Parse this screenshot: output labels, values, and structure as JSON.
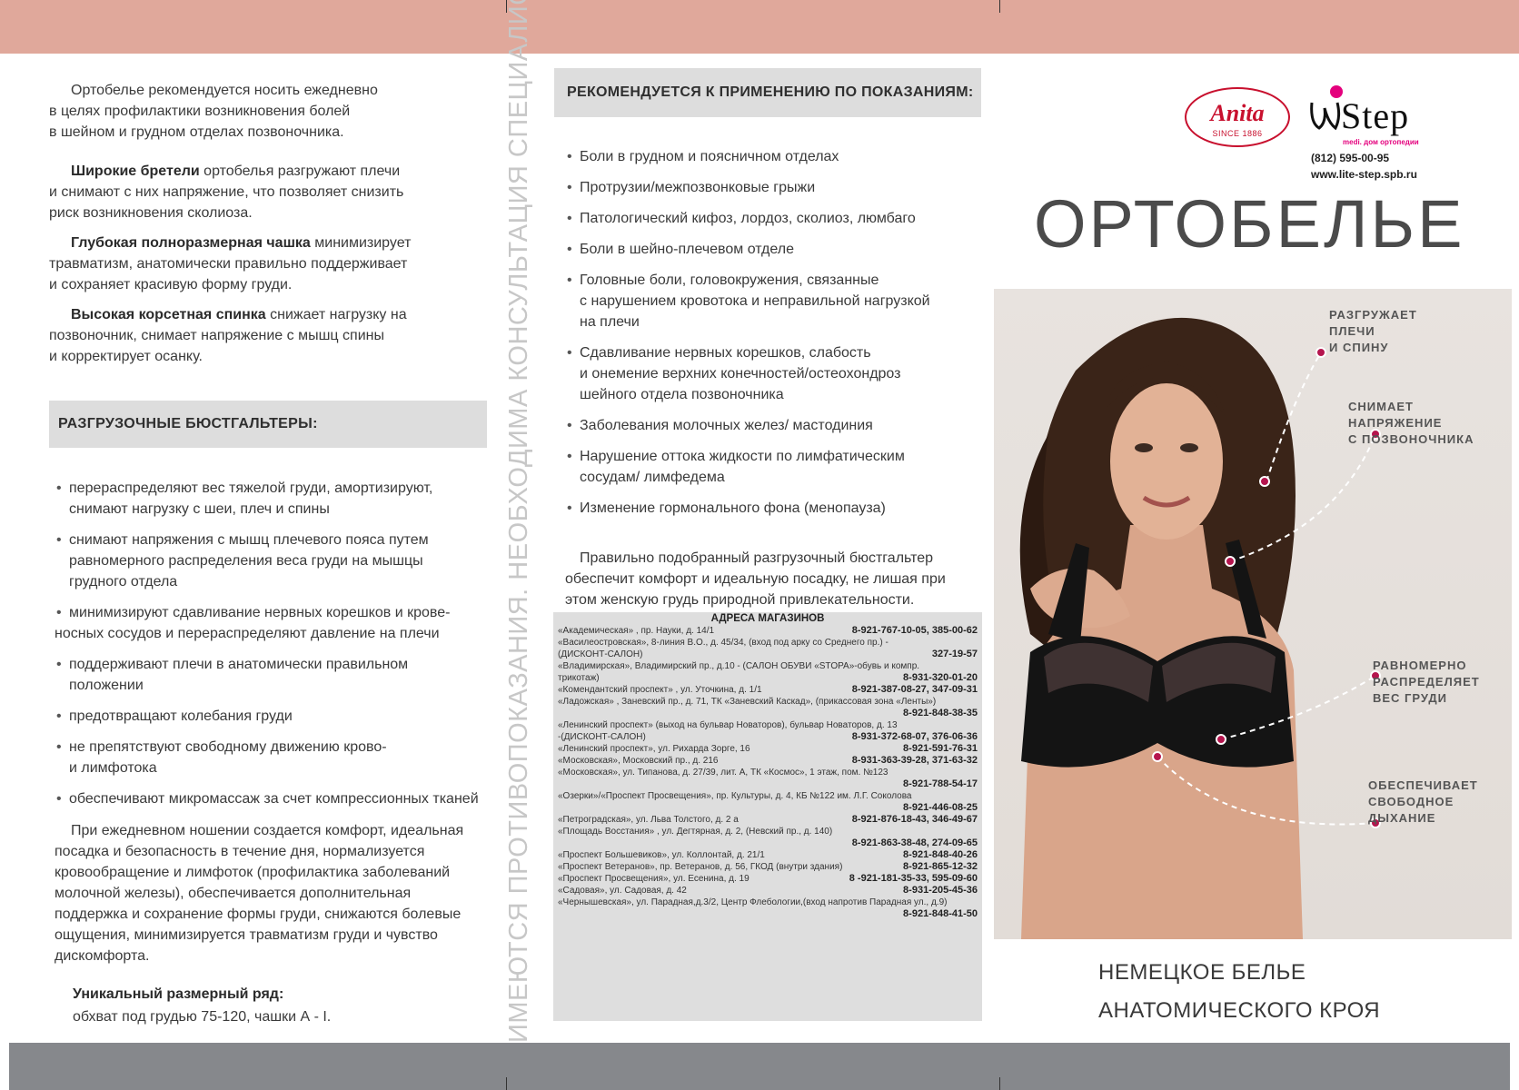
{
  "left_panel": {
    "intro": [
      "Ортобелье рекомендуется носить ежедневно",
      "в целях профилактики возникновения болей",
      "в шейном и грудном отделах позвоночника."
    ],
    "features": [
      {
        "bold": "Широкие бретели",
        "lines": [
          " ортобелья разгружают плечи",
          "и снимают с  них напряжение, что позволяет снизить",
          "риск возникновения сколиоза."
        ]
      },
      {
        "bold": "Глубокая полноразмерная чашка",
        "lines": [
          " минимизирует",
          "травматизм, анатомически правильно поддерживает",
          "и сохраняет красивую форму груди."
        ]
      },
      {
        "bold": "Высокая корсетная спинка",
        "lines": [
          " снижает нагрузку на",
          "позвоночник, снимает напряжение с мышц спины",
          "и корректирует осанку."
        ]
      }
    ],
    "section_title": "РАЗГРУЗОЧНЫЕ БЮСТГАЛЬТЕРЫ:",
    "bullets": [
      [
        "перераспределяют вес тяжелой груди, амортизируют,",
        "снимают нагрузку с шеи, плеч и спины"
      ],
      [
        "снимают напряжения с мышц плечевого пояса путем",
        "равномерного распределения веса груди на мышцы",
        "грудного отдела"
      ],
      [
        "минимизируют сдавливание нервных корешков и крове-",
        "носных сосудов и перераспределяют давление на плечи"
      ],
      [
        "поддерживают плечи в анатомически правильном",
        "положении"
      ],
      [
        "предотвращают колебания груди"
      ],
      [
        "не препятствуют свободному движению крово-",
        "и лимфотока"
      ],
      [
        "обеспечивают микромассаж за счет компрессионных тканей"
      ]
    ],
    "daily_wear": [
      "При ежедневном ношении создается комфорт, идеальная",
      "посадка и безопасность в течение дня, нормализуется",
      "кровообращение и лимфоток (профилактика заболеваний",
      "молочной железы), обеспечивается дополнительная",
      "поддержка и сохранение формы груди, снижаются болевые",
      "ощущения, минимизируется травматизм груди и чувство",
      "дискомфорта."
    ],
    "size_title": "Уникальный размерный ряд:",
    "size_text": "обхват под грудью 75-120, чашки А - I."
  },
  "vertical_slogan": "ИМЕЮТСЯ ПРОТИВОПОКАЗАНИЯ. НЕОБХОДИМА КОНСУЛЬТАЦИЯ СПЕЦИАЛИСТА",
  "middle_panel": {
    "section_title": "РЕКОМЕНДУЕТСЯ К ПРИМЕНЕНИЮ ПО ПОКАЗАНИЯМ:",
    "indications": [
      [
        "Боли в грудном и поясничном отделах"
      ],
      [
        "Протрузии/межпозвонковые грыжи"
      ],
      [
        "Патологический кифоз, лордоз, сколиоз, люмбаго"
      ],
      [
        "Боли в шейно-плечевом отделе"
      ],
      [
        "Головные боли, головокружения, связанные",
        "с нарушением кровотока и неправильной нагрузкой",
        "на плечи"
      ],
      [
        "Сдавливание нервных корешков, слабость",
        "и онемение верхних конечностей/остеохондроз",
        "шейного отдела позвоночника"
      ],
      [
        "Заболевания молочных желез/ мастодиния"
      ],
      [
        "Нарушение оттока жидкости по лимфатическим",
        "сосудам/ лимфедема"
      ],
      [
        "Изменение гормонального фона (менопауза)"
      ]
    ],
    "closing": [
      "Правильно подобранный разгрузочный бюстгальтер",
      "обеспечит комфорт и идеальную посадку, не лишая при",
      "этом женскую грудь природной привлекательности."
    ],
    "stores_title": "АДРЕСА МАГАЗИНОВ",
    "stores": [
      {
        "name": "«Академическая» , пр. Науки, д. 14/1",
        "phone": "8-921-767-10-05, 385-00-62",
        "inline": true
      },
      {
        "name": "«Василеостровская»,  8-линия В.О., д. 45/34, (вход под арку со Среднего пр.) -",
        "name2": "(ДИСКОНТ-САЛОН)",
        "phone": "327-19-57",
        "inline2": true
      },
      {
        "name": "«Владимирская», Владимирский  пр., д.10  - (САЛОН ОБУВИ «STOPA»-обувь и компр.",
        "name2": "трикотаж)",
        "phone": "8-931-320-01-20",
        "inline2": true
      },
      {
        "name": "«Комендантский проспект» , ул. Уточкина, д. 1/1",
        "phone": "8-921-387-08-27, 347-09-31",
        "inline": true
      },
      {
        "name": "«Ладожская» , Заневский пр., д. 71, ТК «Заневский Каскад», (прикассовая зона  «Ленты»)",
        "phone": "8-921-848-38-35",
        "block": true
      },
      {
        "name": "«Ленинский проспект» (выход на бульвар Новаторов), бульвар Новаторов, д. 13",
        "name2": "-(ДИСКОНТ-САЛОН)",
        "phone": "8-931-372-68-07, 376-06-36",
        "inline2": true
      },
      {
        "name": "«Ленинский проспект», ул. Рихарда Зорге, 16",
        "phone": "8-921-591-76-31",
        "inline": true
      },
      {
        "name": "«Московская», Московский пр., д. 216",
        "phone": "8-931-363-39-28, 371-63-32",
        "inline": true
      },
      {
        "name": "«Московская», ул. Типанова, д. 27/39, лит. А, ТК «Космос», 1 этаж, пом. №123",
        "phone": "8-921-788-54-17",
        "block": true
      },
      {
        "name": "«Озерки»/«Проспект Просвещения», пр. Культуры, д. 4, КБ №122 им. Л.Г. Соколова",
        "phone": "8-921-446-08-25",
        "block": true
      },
      {
        "name": "«Петроградская», ул. Льва Толстого, д. 2 а",
        "phone": "8-921-876-18-43, 346-49-67",
        "inline": true
      },
      {
        "name": "«Площадь Восстания» , ул. Дегтярная, д. 2, (Невский пр., д. 140)",
        "phone": "8-921-863-38-48, 274-09-65",
        "block": true
      },
      {
        "name": "«Проспект Большевиков», ул. Коллонтай, д.  21/1",
        "phone": "8-921-848-40-26",
        "inline": true
      },
      {
        "name": "«Проспект Ветеранов», пр. Ветеранов, д. 56, ГКОД  (внутри здания)",
        "phone": "8-921-865-12-32",
        "inline": true
      },
      {
        "name": "«Проспект Просвещения», ул. Есенина, д. 19",
        "phone": "8 -921-181-35-33, 595-09-60",
        "inline": true
      },
      {
        "name": "«Садовая», ул. Садовая, д. 42",
        "phone": "8-931-205-45-36",
        "inline": true
      },
      {
        "name": "«Чернышевская», ул. Парадная,д.3/2, Центр Флебологии,(вход напротив Парадная ул., д.9)",
        "phone": "8-921-848-41-50",
        "block": true
      }
    ]
  },
  "right_panel": {
    "logo_anita": "Anita",
    "logo_anita_since": "SINCE 1886",
    "logo_step": "Step",
    "logo_step_sub": "medi. дом ортопедии",
    "contact_phone": "(812) 595-00-95",
    "contact_site": "www.lite-step.spb.ru",
    "title": "ОРТОБЕЛЬЕ",
    "callouts": [
      [
        "РАЗГРУЖАЕТ",
        "ПЛЕЧИ",
        "И СПИНУ"
      ],
      [
        "СНИМАЕТ",
        "НАПРЯЖЕНИЕ",
        "С ПОЗВОНОЧНИКА"
      ],
      [
        "РАВНОМЕРНО",
        "РАСПРЕДЕЛЯЕТ",
        "ВЕС ГРУДИ"
      ],
      [
        "ОБЕСПЕЧИВАЕТ",
        "СВОБОДНОЕ",
        "ДЫХАНИЕ"
      ]
    ],
    "subtitle": [
      "НЕМЕЦКОЕ БЕЛЬЕ",
      "АНАТОМИЧЕСКОГО КРОЯ"
    ]
  },
  "colors": {
    "top_band": "#e0a89b",
    "bottom_band": "#86888c",
    "section_bar": "#dddddd",
    "accent_magenta": "#b5154e",
    "anita_red": "#c8102e"
  }
}
